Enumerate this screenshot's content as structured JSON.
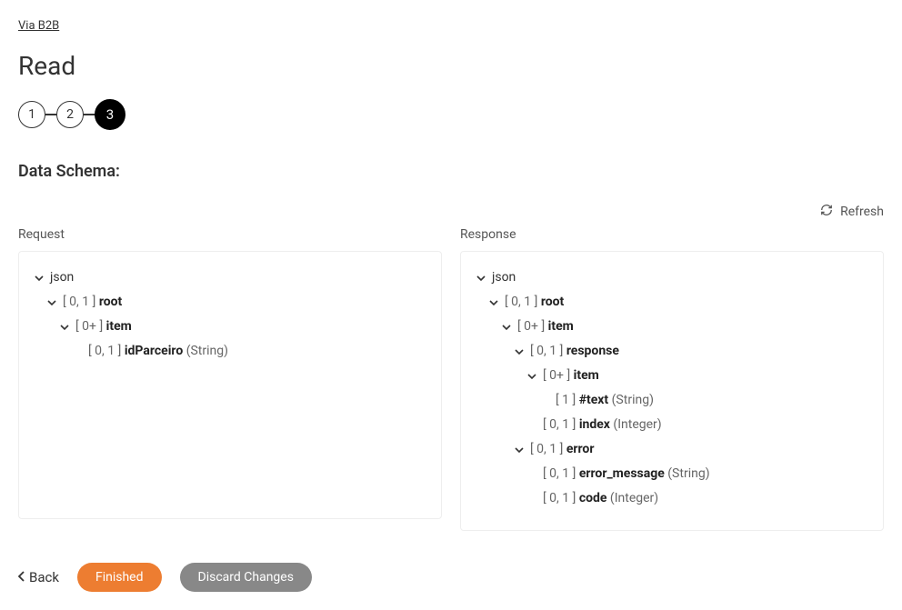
{
  "breadcrumb": "Via B2B",
  "page_title": "Read",
  "stepper": {
    "steps": [
      "1",
      "2",
      "3"
    ],
    "active_index": 2
  },
  "section_title": "Data Schema:",
  "refresh_label": "Refresh",
  "request_label": "Request",
  "response_label": "Response",
  "request_tree": [
    {
      "indent": 0,
      "chev": true,
      "card": "",
      "name": "json",
      "type": "",
      "name_weight": "normal"
    },
    {
      "indent": 1,
      "chev": true,
      "card": "[ 0, 1 ]",
      "name": "root",
      "type": ""
    },
    {
      "indent": 2,
      "chev": true,
      "card": "[ 0+ ]",
      "name": "item",
      "type": ""
    },
    {
      "indent": 3,
      "chev": false,
      "card": "[ 0, 1 ]",
      "name": "idParceiro",
      "type": "(String)"
    }
  ],
  "response_tree": [
    {
      "indent": 0,
      "chev": true,
      "card": "",
      "name": "json",
      "type": "",
      "name_weight": "normal"
    },
    {
      "indent": 1,
      "chev": true,
      "card": "[ 0, 1 ]",
      "name": "root",
      "type": ""
    },
    {
      "indent": 2,
      "chev": true,
      "card": "[ 0+ ]",
      "name": "item",
      "type": ""
    },
    {
      "indent": 3,
      "chev": true,
      "card": "[ 0, 1 ]",
      "name": "response",
      "type": ""
    },
    {
      "indent": 4,
      "chev": true,
      "card": "[ 0+ ]",
      "name": "item",
      "type": ""
    },
    {
      "indent": 5,
      "chev": false,
      "card": "[ 1 ]",
      "name": "#text",
      "type": "(String)"
    },
    {
      "indent": 4,
      "chev": false,
      "card": "[ 0, 1 ]",
      "name": "index",
      "type": "(Integer)"
    },
    {
      "indent": 3,
      "chev": true,
      "card": "[ 0, 1 ]",
      "name": "error",
      "type": ""
    },
    {
      "indent": 4,
      "chev": false,
      "card": "[ 0, 1 ]",
      "name": "error_message",
      "type": "(String)"
    },
    {
      "indent": 4,
      "chev": false,
      "card": "[ 0, 1 ]",
      "name": "code",
      "type": "(Integer)"
    }
  ],
  "footer": {
    "back": "Back",
    "finished": "Finished",
    "discard": "Discard Changes"
  }
}
